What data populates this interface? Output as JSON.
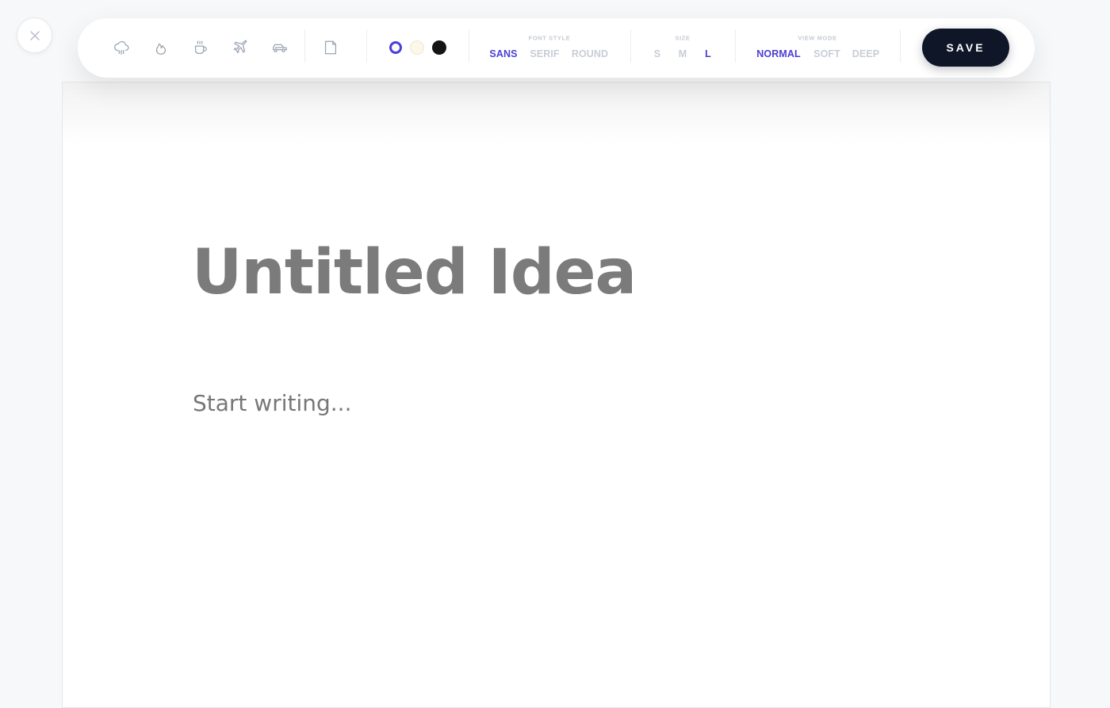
{
  "close": {
    "icon": "close-icon"
  },
  "toolbar": {
    "mood_icons": [
      {
        "name": "rain-cloud-icon"
      },
      {
        "name": "flame-icon"
      },
      {
        "name": "coffee-cup-icon"
      },
      {
        "name": "airplane-icon"
      },
      {
        "name": "car-icon"
      }
    ],
    "page_icon": "note-page-icon",
    "colors": [
      {
        "name": "purple",
        "hex": "#4c3fd6",
        "selected": true
      },
      {
        "name": "cream",
        "hex": "#fbf8e8",
        "selected": false
      },
      {
        "name": "black",
        "hex": "#141414",
        "selected": false
      }
    ],
    "font_style": {
      "label": "FONT STYLE",
      "options": [
        "SANS",
        "SERIF",
        "ROUND"
      ],
      "selected": "SANS"
    },
    "size": {
      "label": "SIZE",
      "options": [
        "S",
        "M",
        "L"
      ],
      "selected": "L"
    },
    "view_mode": {
      "label": "VIEW MODE",
      "options": [
        "NORMAL",
        "SOFT",
        "DEEP"
      ],
      "selected": "NORMAL"
    },
    "save_label": "SAVE"
  },
  "editor": {
    "title_placeholder": "Untitled Idea",
    "body_placeholder": "Start writing..."
  },
  "accent_color": "#4c3fd6"
}
